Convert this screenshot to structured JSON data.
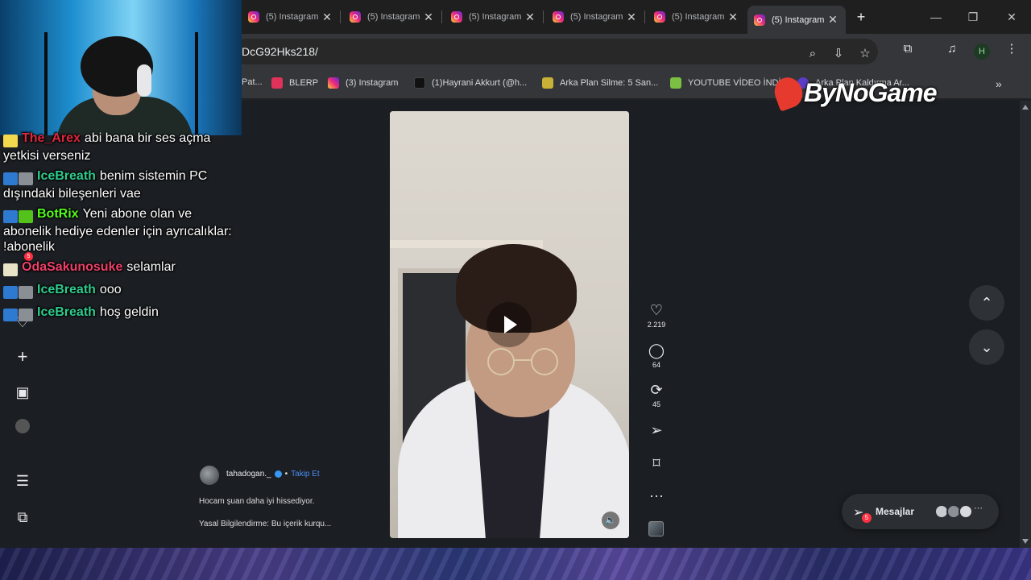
{
  "browser": {
    "tabs": [
      {
        "label": "(5) Instagram",
        "active": false
      },
      {
        "label": "(5) Instagram",
        "active": false
      },
      {
        "label": "(5) Instagram",
        "active": false
      },
      {
        "label": "(5) Instagram",
        "active": false
      },
      {
        "label": "(5) Instagram",
        "active": false
      },
      {
        "label": "(5) Instagram",
        "active": true
      }
    ],
    "url": "DcG92Hks218/",
    "profile_initial": "H",
    "bookmarks": [
      {
        "label": "Pat...",
        "color": "#6a8fd6"
      },
      {
        "label": "BLERP",
        "color": "#e0325a"
      },
      {
        "label": "(3) Instagram",
        "color": "#d6249f"
      },
      {
        "label": "(1)Hayrani Akkurt (@h...",
        "color": "#111111"
      },
      {
        "label": "Arka Plan Silme: 5 San...",
        "color": "#c9b037"
      },
      {
        "label": "YOUTUBE VİDEO İNDİR",
        "color": "#7bc043"
      },
      {
        "label": "Arka Plan Kaldırma Ar...",
        "color": "#5b3cc4"
      }
    ]
  },
  "reel": {
    "likes": "2.219",
    "comments": "64",
    "reposts": "45",
    "author": "tahadogan._",
    "follow_label": "Takip Et",
    "caption": "Hocam şuan daha iyi hissediyor.",
    "disclaimer": "Yasal Bilgilendirme: Bu içerik kurqu..."
  },
  "messages": {
    "label": "Mesajlar",
    "badge": "5"
  },
  "sidebar": {
    "notification_badge": "5"
  },
  "watermark": "ByNoGame",
  "chat": [
    {
      "user": "The_Arex",
      "user_color": "#e0263c",
      "text": "abi bana bir ses açma yetkisi verseniz",
      "badges": [
        "#f2d94e"
      ]
    },
    {
      "user": "IceBreath",
      "user_color": "#2ecc8f",
      "text": "benim sistemin PC dışındaki bileşenleri vae",
      "badges": [
        "#2e7ad1",
        "#8a8f96"
      ]
    },
    {
      "user": "BotRix",
      "user_color": "#53fc18",
      "text": "Yeni abone olan ve abonelik hediye edenler için ayrıcalıklar: !abonelik",
      "badges": [
        "#2e7ad1",
        "#53c21a"
      ]
    },
    {
      "user": "OdaSakunosuke",
      "user_color": "#ef3f6a",
      "text": "selamlar",
      "badges": [
        "#e9e4c8"
      ]
    },
    {
      "user": "IceBreath",
      "user_color": "#2ecc8f",
      "text": "ooo",
      "badges": [
        "#2e7ad1",
        "#8a8f96"
      ]
    },
    {
      "user": "IceBreath",
      "user_color": "#2ecc8f",
      "text": "hoş geldin",
      "badges": [
        "#2e7ad1",
        "#8a8f96"
      ]
    }
  ]
}
